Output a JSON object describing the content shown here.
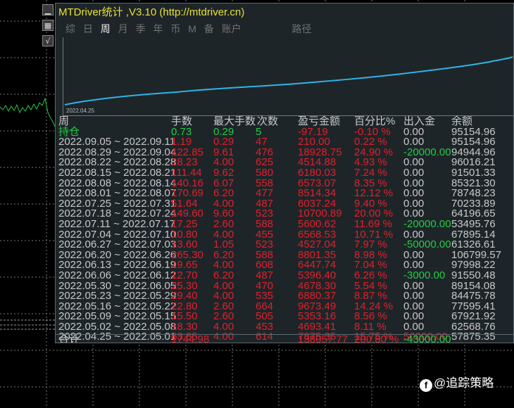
{
  "window": {
    "title": "MTDriver统计 ,V3.10 (http://mtdriver.cn)"
  },
  "toolbar": {
    "buttons": [
      {
        "icon": "minimize-icon",
        "glyph": "▁"
      },
      {
        "icon": "grid-icon",
        "glyph": "▦"
      },
      {
        "icon": "check-icon",
        "glyph": "√"
      }
    ]
  },
  "menu": {
    "items": [
      "综",
      "日",
      "周",
      "月",
      "季",
      "年",
      "币",
      "M",
      "备",
      "账户"
    ],
    "active_index": 2,
    "extra": "路径"
  },
  "equity_chart": {
    "start_date_label": "2022.04.25",
    "line_color": "#2fb3e8"
  },
  "table": {
    "headers": [
      "周",
      "手数",
      "最大手数",
      "次数",
      "盈亏金额",
      "百分比%",
      "出入金",
      "余额"
    ],
    "position_row": {
      "label": "持仓",
      "lots": "0.73",
      "max_lots": "0.29",
      "count": "5",
      "pnl": "-97.19",
      "percent": "-0.10 %",
      "deposit": "0.00",
      "balance": "95154.96"
    },
    "rows": [
      {
        "week": "2022.09.05 ~ 2022.09.11",
        "lots": "1.19",
        "max_lots": "0.29",
        "count": "47",
        "pnl": "210.00",
        "percent": "0.22 %",
        "deposit": "0.00",
        "balance": "95154.96"
      },
      {
        "week": "2022.08.29 ~ 2022.09.04",
        "lots": "122.85",
        "max_lots": "9.61",
        "count": "476",
        "pnl": "18928.75",
        "percent": "24.90 %",
        "deposit": "-20000.00",
        "balance": "94944.96"
      },
      {
        "week": "2022.08.22 ~ 2022.08.28",
        "lots": "28.23",
        "max_lots": "4.00",
        "count": "625",
        "pnl": "4514.88",
        "percent": "4.93 %",
        "deposit": "0.00",
        "balance": "96016.21"
      },
      {
        "week": "2022.08.15 ~ 2022.08.21",
        "lots": "111.44",
        "max_lots": "9.62",
        "count": "580",
        "pnl": "6180.03",
        "percent": "7.24 %",
        "deposit": "0.00",
        "balance": "91501.33"
      },
      {
        "week": "2022.08.08 ~ 2022.08.14",
        "lots": "140.16",
        "max_lots": "6.07",
        "count": "558",
        "pnl": "6573.07",
        "percent": "8.35 %",
        "deposit": "0.00",
        "balance": "85321.30"
      },
      {
        "week": "2022.08.01 ~ 2022.08.07",
        "lots": "170.69",
        "max_lots": "6.20",
        "count": "477",
        "pnl": "8514.34",
        "percent": "12.12 %",
        "deposit": "0.00",
        "balance": "78748.23"
      },
      {
        "week": "2022.07.25 ~ 2022.07.31",
        "lots": "51.64",
        "max_lots": "4.00",
        "count": "487",
        "pnl": "6037.24",
        "percent": "9.40 %",
        "deposit": "0.00",
        "balance": "70233.89"
      },
      {
        "week": "2022.07.18 ~ 2022.07.24",
        "lots": "149.60",
        "max_lots": "9.60",
        "count": "523",
        "pnl": "10700.89",
        "percent": "20.00 %",
        "deposit": "0.00",
        "balance": "64196.65"
      },
      {
        "week": "2022.07.11 ~ 2022.07.17",
        "lots": "17.25",
        "max_lots": "2.60",
        "count": "588",
        "pnl": "5600.62",
        "percent": "11.69 %",
        "deposit": "-20000.00",
        "balance": "53495.76"
      },
      {
        "week": "2022.07.04 ~ 2022.07.10",
        "lots": "10.80",
        "max_lots": "4.00",
        "count": "455",
        "pnl": "6568.53",
        "percent": "10.71 %",
        "deposit": "0.00",
        "balance": "67895.14"
      },
      {
        "week": "2022.06.27 ~ 2022.07.03",
        "lots": "13.60",
        "max_lots": "1.05",
        "count": "523",
        "pnl": "4527.04",
        "percent": "7.97 %",
        "deposit": "-50000.00",
        "balance": "61326.61"
      },
      {
        "week": "2022.06.20 ~ 2022.06.26",
        "lots": "265.30",
        "max_lots": "6.20",
        "count": "588",
        "pnl": "8801.35",
        "percent": "8.98 %",
        "deposit": "0.00",
        "balance": "106799.57"
      },
      {
        "week": "2022.06.13 ~ 2022.06.19",
        "lots": "19.65",
        "max_lots": "4.00",
        "count": "608",
        "pnl": "6447.74",
        "percent": "7.04 %",
        "deposit": "0.00",
        "balance": "97998.22"
      },
      {
        "week": "2022.06.06 ~ 2022.06.12",
        "lots": "12.70",
        "max_lots": "6.20",
        "count": "487",
        "pnl": "5396.40",
        "percent": "6.26 %",
        "deposit": "-3000.00",
        "balance": "91550.48"
      },
      {
        "week": "2022.05.30 ~ 2022.06.05",
        "lots": "25.30",
        "max_lots": "4.00",
        "count": "470",
        "pnl": "4678.30",
        "percent": "5.54 %",
        "deposit": "0.00",
        "balance": "89154.08"
      },
      {
        "week": "2022.05.23 ~ 2022.05.29",
        "lots": "29.40",
        "max_lots": "4.00",
        "count": "535",
        "pnl": "6880.37",
        "percent": "8.87 %",
        "deposit": "0.00",
        "balance": "84475.78"
      },
      {
        "week": "2022.05.16 ~ 2022.05.22",
        "lots": "22.80",
        "max_lots": "2.60",
        "count": "664",
        "pnl": "9673.49",
        "percent": "14.24 %",
        "deposit": "0.00",
        "balance": "77595.41"
      },
      {
        "week": "2022.05.09 ~ 2022.05.15",
        "lots": "15.50",
        "max_lots": "2.60",
        "count": "505",
        "pnl": "5353.16",
        "percent": "8.56 %",
        "deposit": "0.00",
        "balance": "67921.92"
      },
      {
        "week": "2022.05.02 ~ 2022.05.08",
        "lots": "18.30",
        "max_lots": "4.00",
        "count": "453",
        "pnl": "4693.41",
        "percent": "8.11 %",
        "deposit": "0.00",
        "balance": "62568.76"
      },
      {
        "week": "2022.04.25 ~ 2022.05.01",
        "lots": "63.85",
        "max_lots": "4.00",
        "count": "614",
        "pnl": "7875.35",
        "percent": "15.75 %",
        "deposit": "50000.00",
        "balance": "57875.35"
      }
    ],
    "total_row": {
      "label": "合计",
      "lots": "1744.98",
      "pnl": "138057.77",
      "percent": "200.80 %",
      "deposit": "-43000.00"
    }
  },
  "watermark": {
    "text": "@追踪策略",
    "icon": "social-logo-icon"
  },
  "colors": {
    "positive": "#22cc44",
    "negative": "#e0202a",
    "neutral": "#c8c8c8",
    "title": "#e8e230"
  }
}
